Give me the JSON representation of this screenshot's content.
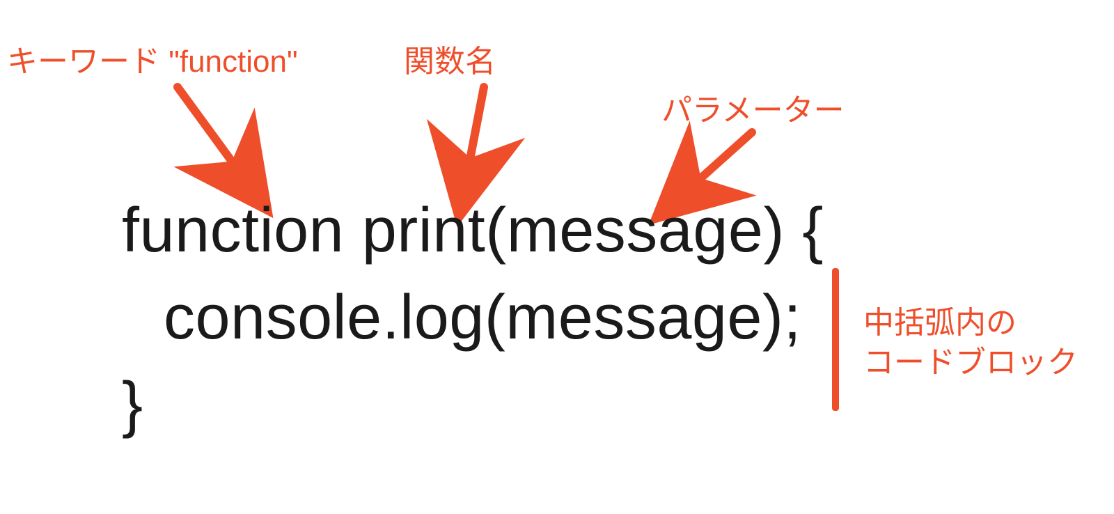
{
  "annotations": {
    "keyword": "キーワード \"function\"",
    "function_name": "関数名",
    "parameter": "パラメーター",
    "code_block_line1": "中括弧内の",
    "code_block_line2": "コードブロック"
  },
  "code": {
    "line1": "function print(message) {",
    "line2": "console.log(message);",
    "line3": "}"
  },
  "colors": {
    "annotation": "#ef4e2b",
    "code": "#1a1a1a"
  }
}
